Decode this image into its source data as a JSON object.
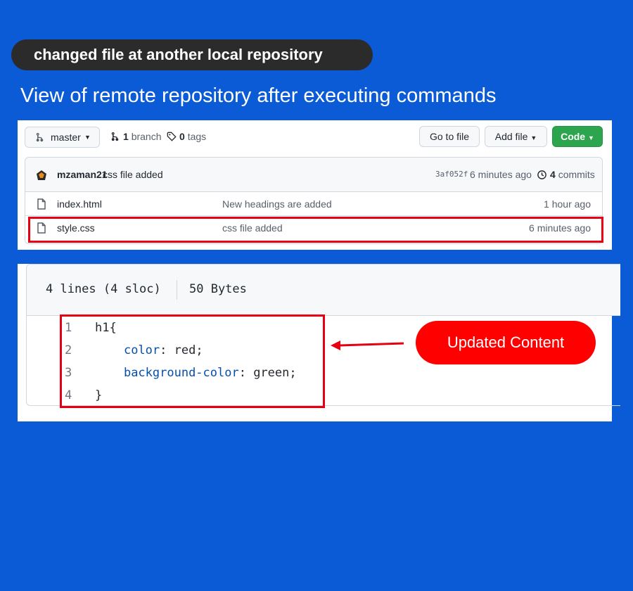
{
  "header": {
    "pill": "changed file at another local repository",
    "subtitle": "View of remote repository after executing commands"
  },
  "repo": {
    "branch": "master",
    "branch_count": "1",
    "branch_word": "branch",
    "tag_count": "0",
    "tag_word": "tags",
    "go_to_file": "Go to file",
    "add_file": "Add file",
    "code": "Code",
    "latest_commit": {
      "author": "mzaman21",
      "message": "css file added",
      "hash": "3af052f",
      "time": "6 minutes ago",
      "commit_count": "4",
      "commit_word": "commits"
    },
    "files": [
      {
        "name": "index.html",
        "message": "New headings are added",
        "time": "1 hour ago"
      },
      {
        "name": "style.css",
        "message": "css file added",
        "time": "6 minutes ago"
      }
    ]
  },
  "code_view": {
    "lines_info": "4 lines (4 sloc)",
    "size": "50 Bytes",
    "lines": [
      {
        "n": "1",
        "prop": "",
        "rest": "h1{"
      },
      {
        "n": "2",
        "prop": "color",
        "rest": ": red;"
      },
      {
        "n": "3",
        "prop": "background-color",
        "rest": ": green;"
      },
      {
        "n": "4",
        "prop": "",
        "rest": "}"
      }
    ]
  },
  "callout": "Updated Content",
  "colors": {
    "background": "#0b5bd6",
    "highlight": "#e60012",
    "callout": "#ff0000",
    "code_button": "#2da44e"
  }
}
